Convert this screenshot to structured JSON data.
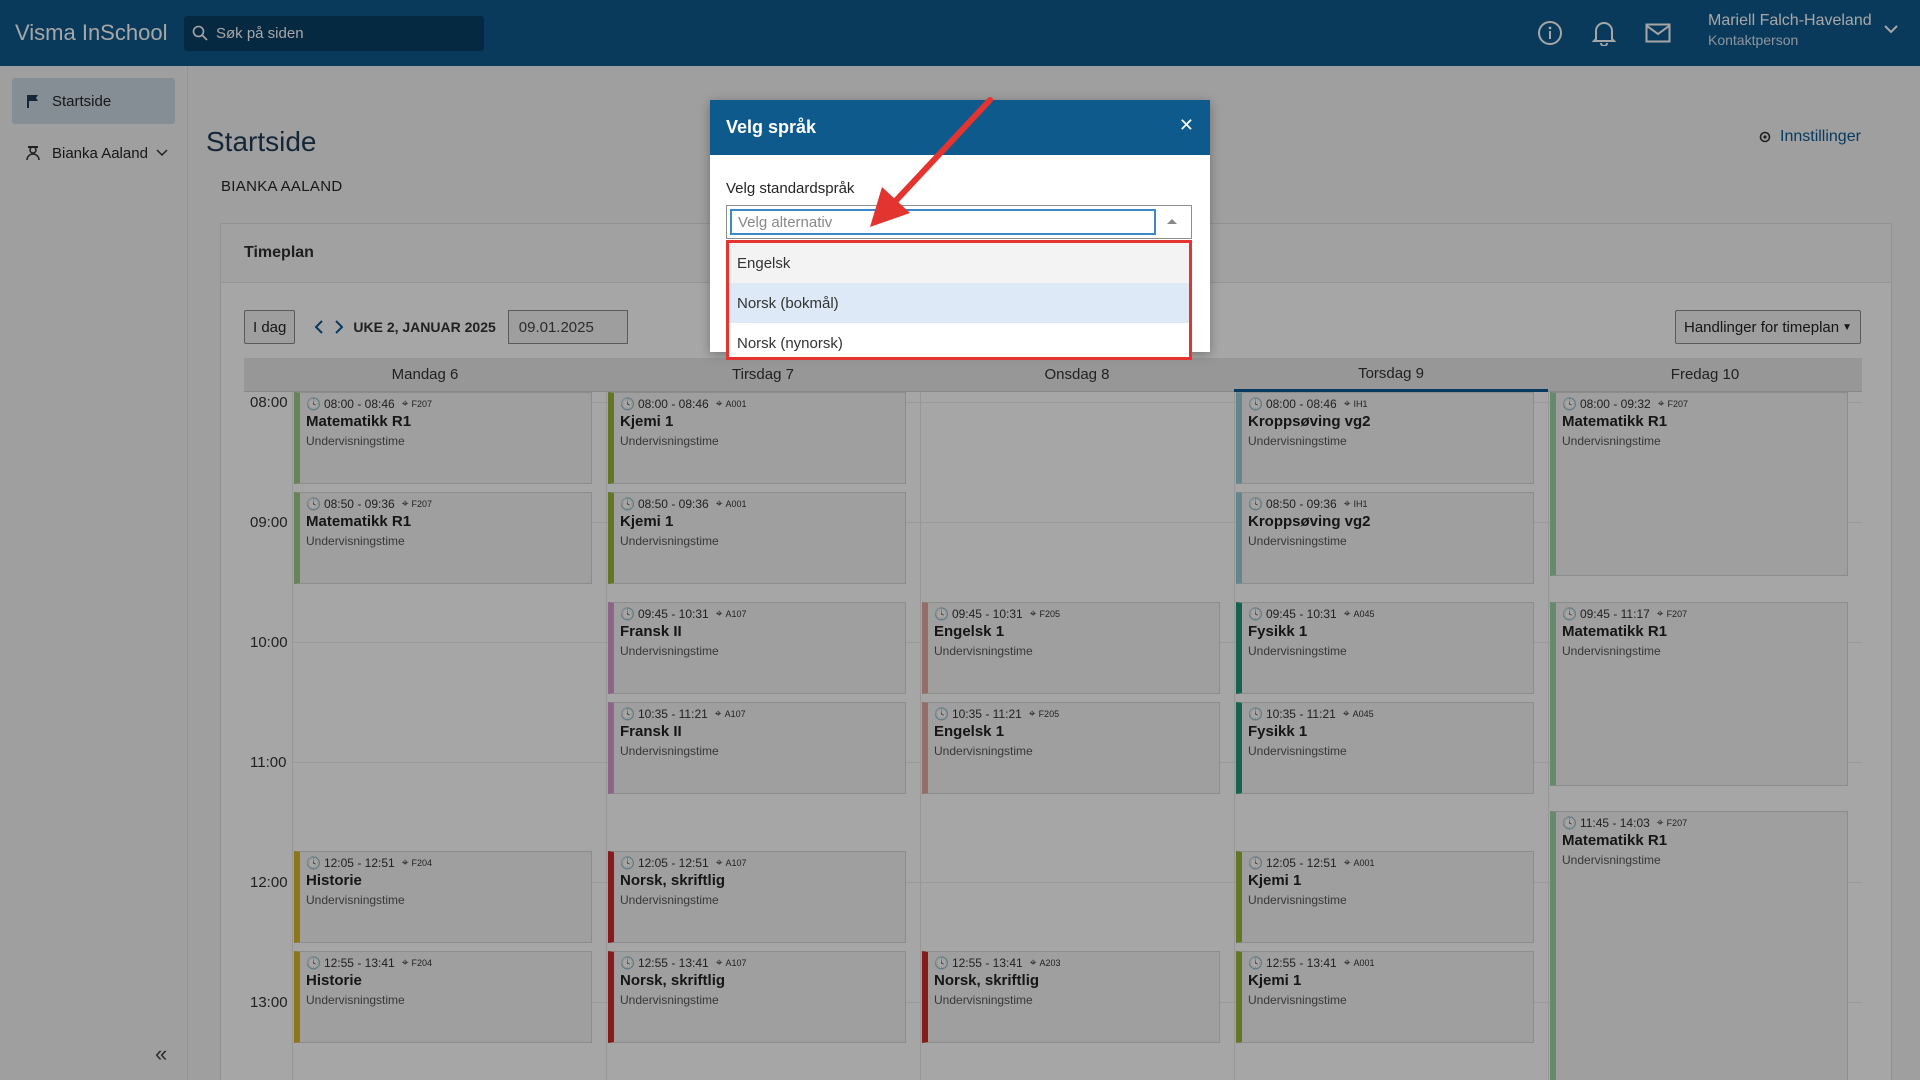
{
  "app": {
    "brand": "Visma InSchool",
    "search_placeholder": "Søk på siden",
    "user_name": "Mariell Falch-Haveland",
    "user_role": "Kontaktperson"
  },
  "sidebar": {
    "items": [
      {
        "label": "Startside",
        "icon": "flag-icon"
      },
      {
        "label": "Bianka Aaland",
        "icon": "student-icon"
      }
    ]
  },
  "page": {
    "title": "Startside",
    "settings_label": "Innstillinger",
    "student_name": "BIANKA AALAND",
    "card_title": "Timeplan",
    "today_button": "I dag",
    "week_label": "UKE 2, JANUAR 2025",
    "date_value": "09.01.2025",
    "actions_button": "Handlinger for timeplan"
  },
  "schedule": {
    "days": [
      "Mandag 6",
      "Tirsdag 7",
      "Onsdag 8",
      "Torsdag 9",
      "Fredag 10"
    ],
    "today": "Torsdag 9",
    "hours": [
      "08:00",
      "09:00",
      "10:00",
      "11:00",
      "12:00",
      "13:00"
    ],
    "lessons": [
      {
        "time": "08:00 - 08:46",
        "room": "F207",
        "name": "Matematikk R1",
        "kind": "Undervisningstime"
      },
      {
        "time": "08:50 - 09:36",
        "room": "F207",
        "name": "Matematikk R1",
        "kind": "Undervisningstime"
      },
      {
        "time": "12:05 - 12:51",
        "room": "F204",
        "name": "Historie",
        "kind": "Undervisningstime"
      },
      {
        "time": "12:55 - 13:41",
        "room": "F204",
        "name": "Historie",
        "kind": "Undervisningstime"
      },
      {
        "time": "08:00 - 08:46",
        "room": "A001",
        "name": "Kjemi 1",
        "kind": "Undervisningstime"
      },
      {
        "time": "08:50 - 09:36",
        "room": "A001",
        "name": "Kjemi 1",
        "kind": "Undervisningstime"
      },
      {
        "time": "09:45 - 10:31",
        "room": "A107",
        "name": "Fransk II",
        "kind": "Undervisningstime"
      },
      {
        "time": "10:35 - 11:21",
        "room": "A107",
        "name": "Fransk II",
        "kind": "Undervisningstime"
      },
      {
        "time": "12:05 - 12:51",
        "room": "A107",
        "name": "Norsk, skriftlig",
        "kind": "Undervisningstime"
      },
      {
        "time": "12:55 - 13:41",
        "room": "A107",
        "name": "Norsk, skriftlig",
        "kind": "Undervisningstime"
      },
      {
        "time": "09:45 - 10:31",
        "room": "F205",
        "name": "Engelsk 1",
        "kind": "Undervisningstime"
      },
      {
        "time": "10:35 - 11:21",
        "room": "F205",
        "name": "Engelsk 1",
        "kind": "Undervisningstime"
      },
      {
        "time": "12:55 - 13:41",
        "room": "A203",
        "name": "Norsk, skriftlig",
        "kind": "Undervisningstime"
      },
      {
        "time": "08:00 - 08:46",
        "room": "IH1",
        "name": "Kroppsøving vg2",
        "kind": "Undervisningstime"
      },
      {
        "time": "08:50 - 09:36",
        "room": "IH1",
        "name": "Kroppsøving vg2",
        "kind": "Undervisningstime"
      },
      {
        "time": "09:45 - 10:31",
        "room": "A045",
        "name": "Fysikk 1",
        "kind": "Undervisningstime"
      },
      {
        "time": "10:35 - 11:21",
        "room": "A045",
        "name": "Fysikk 1",
        "kind": "Undervisningstime"
      },
      {
        "time": "12:05 - 12:51",
        "room": "A001",
        "name": "Kjemi 1",
        "kind": "Undervisningstime"
      },
      {
        "time": "12:55 - 13:41",
        "room": "A001",
        "name": "Kjemi 1",
        "kind": "Undervisningstime"
      },
      {
        "time": "08:00 - 09:32",
        "room": "F207",
        "name": "Matematikk R1",
        "kind": "Undervisningstime"
      },
      {
        "time": "09:45 - 11:17",
        "room": "F207",
        "name": "Matematikk R1",
        "kind": "Undervisningstime"
      },
      {
        "time": "11:45 - 14:03",
        "room": "F207",
        "name": "Matematikk R1",
        "kind": "Undervisningstime"
      }
    ]
  },
  "modal": {
    "title": "Velg språk",
    "label": "Velg standardspråk",
    "placeholder": "Velg alternativ",
    "options": [
      "Engelsk",
      "Norsk (bokmål)",
      "Norsk (nynorsk)"
    ],
    "highlighted_option": "Norsk (bokmål)"
  },
  "colors": {
    "topbar": "#0e5a8c",
    "accent": "#0d5a94",
    "annotation_red": "#e3342f"
  }
}
